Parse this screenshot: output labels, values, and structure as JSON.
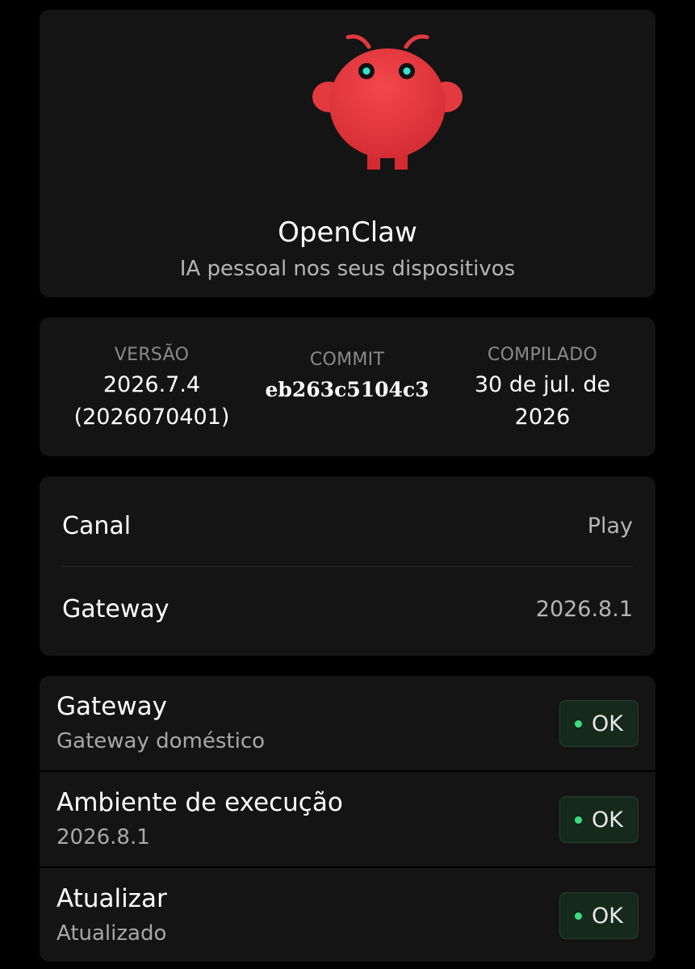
{
  "app": {
    "name": "OpenClaw",
    "tagline": "IA pessoal nos seus dispositivos",
    "mascot_icon": "red-lobster-mascot",
    "brand_color": "#e8373e",
    "eye_color": "#35e2d0"
  },
  "build": {
    "version_label": "VERSÃO",
    "version_line1": "2026.7.4",
    "version_line2": "(2026070401)",
    "commit_label": "COMMIT",
    "commit_value": "eb263c5104c3",
    "compiled_label": "COMPILADO",
    "compiled_line1": "30 de jul. de",
    "compiled_line2": "2026"
  },
  "info": {
    "rows": [
      {
        "key": "Canal",
        "value": "Play"
      },
      {
        "key": "Gateway",
        "value": "2026.8.1"
      }
    ]
  },
  "status": {
    "ok_color": "#3ddc84",
    "rows": [
      {
        "title": "Gateway",
        "subtitle": "Gateway doméstico",
        "badge": "OK"
      },
      {
        "title": "Ambiente de execução",
        "subtitle": "2026.8.1",
        "badge": "OK"
      },
      {
        "title": "Atualizar",
        "subtitle": "Atualizado",
        "badge": "OK"
      }
    ]
  }
}
